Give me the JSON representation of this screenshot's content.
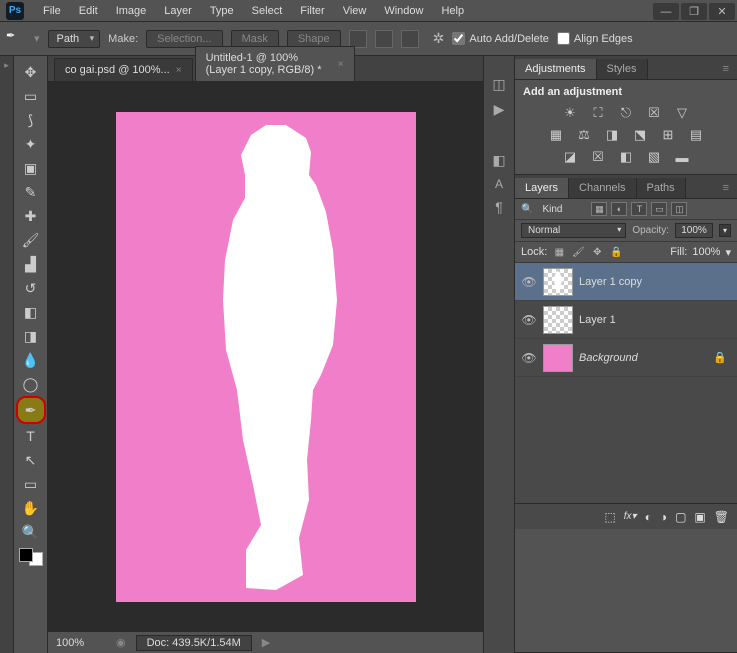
{
  "menu": [
    "File",
    "Edit",
    "Image",
    "Layer",
    "Type",
    "Select",
    "Filter",
    "View",
    "Window",
    "Help"
  ],
  "options": {
    "mode": "Path",
    "make": "Make:",
    "selection": "Selection...",
    "mask": "Mask",
    "shape": "Shape",
    "autoadd": "Auto Add/Delete",
    "alignedges": "Align Edges"
  },
  "tabs": [
    {
      "title": "co gai.psd @ 100%...",
      "active": false
    },
    {
      "title": "Untitled-1 @ 100% (Layer 1 copy, RGB/8) *",
      "active": true
    }
  ],
  "status": {
    "zoom": "100%",
    "doc": "Doc: 439.5K/1.54M"
  },
  "adjustments": {
    "tab1": "Adjustments",
    "tab2": "Styles",
    "header": "Add an adjustment"
  },
  "layerspanel": {
    "tab1": "Layers",
    "tab2": "Channels",
    "tab3": "Paths",
    "kind": "Kind",
    "blend": "Normal",
    "opacity_lbl": "Opacity:",
    "opacity": "100%",
    "lock": "Lock:",
    "fill_lbl": "Fill:",
    "fill": "100%",
    "layers": [
      {
        "name": "Layer 1 copy",
        "sel": true,
        "thumb": "checker-sil",
        "locked": false,
        "italic": false
      },
      {
        "name": "Layer 1",
        "sel": false,
        "thumb": "checker",
        "locked": false,
        "italic": false
      },
      {
        "name": "Background",
        "sel": false,
        "thumb": "pink",
        "locked": true,
        "italic": true
      }
    ]
  }
}
